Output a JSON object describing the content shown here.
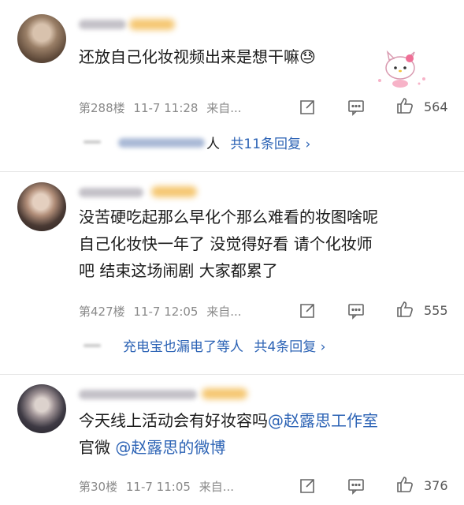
{
  "comments": [
    {
      "content_lines": [
        "还放自己化妆视频出来是想干嘛😓"
      ],
      "meta": {
        "floor": "第288楼",
        "time": "11-7 11:28",
        "source": "来自...",
        "likes": "564"
      },
      "replies": {
        "suffix": "人",
        "count_label": "共11条回复 ›"
      }
    },
    {
      "content_lines": [
        "没苦硬吃起那么早化个那么难看的妆图啥呢",
        "自己化妆快一年了 没觉得好看 请个化妆师",
        "吧 结束这场闹剧 大家都累了"
      ],
      "meta": {
        "floor": "第427楼",
        "time": "11-7 12:05",
        "source": "来自...",
        "likes": "555"
      },
      "replies": {
        "text": "充电宝也漏电了等人",
        "count_label": "共4条回复 ›"
      }
    },
    {
      "content_lines": [
        "今天线上活动会有好妆容吗",
        "官微 "
      ],
      "mentions": [
        "@赵露思工作室",
        "@赵露思的微博"
      ],
      "meta": {
        "floor": "第30楼",
        "time": "11-7 11:05",
        "source": "来自...",
        "likes": "376"
      }
    }
  ],
  "icons": {
    "share": "share-icon",
    "comment": "comment-icon",
    "like": "thumbs-up-icon",
    "sticker": "hello-kitty-sticker-icon"
  },
  "colors": {
    "link": "#2c63b5",
    "meta": "#8a8a8a",
    "text": "#1a1a1a"
  }
}
